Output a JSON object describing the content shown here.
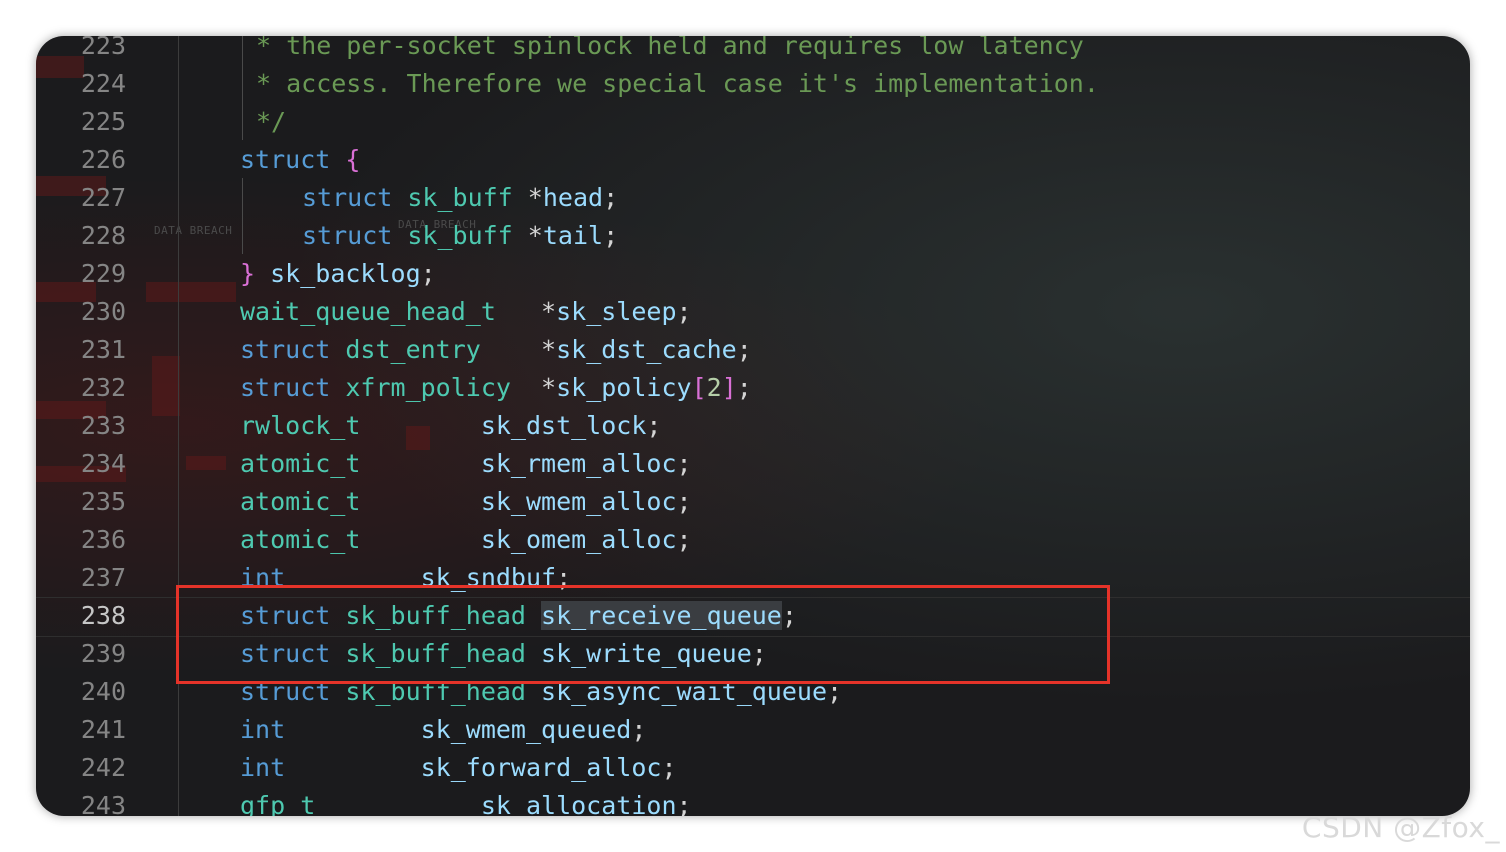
{
  "lines": [
    {
      "num": "223",
      "tokens": [
        {
          "c": "c",
          "t": "* the per-socket spinlock held and requires low latency"
        }
      ],
      "indent": 1
    },
    {
      "num": "224",
      "tokens": [
        {
          "c": "c",
          "t": "* access. Therefore we special case it's implementation."
        }
      ],
      "indent": 1
    },
    {
      "num": "225",
      "tokens": [
        {
          "c": "c",
          "t": "*/"
        }
      ],
      "indent": 1
    },
    {
      "num": "226",
      "tokens": [
        {
          "c": "k",
          "t": "struct "
        },
        {
          "c": "p",
          "t": "{"
        }
      ],
      "indent": 0
    },
    {
      "num": "227",
      "tokens": [
        {
          "c": "k",
          "t": "struct "
        },
        {
          "c": "t",
          "t": "sk_buff "
        },
        {
          "c": "d",
          "t": "*"
        },
        {
          "c": "v",
          "t": "head"
        },
        {
          "c": "d",
          "t": ";"
        }
      ],
      "indent": 2
    },
    {
      "num": "228",
      "tokens": [
        {
          "c": "k",
          "t": "struct "
        },
        {
          "c": "t",
          "t": "sk_buff "
        },
        {
          "c": "d",
          "t": "*"
        },
        {
          "c": "v",
          "t": "tail"
        },
        {
          "c": "d",
          "t": ";"
        }
      ],
      "indent": 2
    },
    {
      "num": "229",
      "tokens": [
        {
          "c": "p",
          "t": "} "
        },
        {
          "c": "v",
          "t": "sk_backlog"
        },
        {
          "c": "d",
          "t": ";"
        }
      ],
      "indent": 0
    },
    {
      "num": "230",
      "tokens": [
        {
          "c": "t",
          "t": "wait_queue_head_t   "
        },
        {
          "c": "d",
          "t": "*"
        },
        {
          "c": "v",
          "t": "sk_sleep"
        },
        {
          "c": "d",
          "t": ";"
        }
      ],
      "indent": 0
    },
    {
      "num": "231",
      "tokens": [
        {
          "c": "k",
          "t": "struct "
        },
        {
          "c": "t",
          "t": "dst_entry    "
        },
        {
          "c": "d",
          "t": "*"
        },
        {
          "c": "v",
          "t": "sk_dst_cache"
        },
        {
          "c": "d",
          "t": ";"
        }
      ],
      "indent": 0
    },
    {
      "num": "232",
      "tokens": [
        {
          "c": "k",
          "t": "struct "
        },
        {
          "c": "t",
          "t": "xfrm_policy  "
        },
        {
          "c": "d",
          "t": "*"
        },
        {
          "c": "v",
          "t": "sk_policy"
        },
        {
          "c": "p",
          "t": "["
        },
        {
          "c": "n",
          "t": "2"
        },
        {
          "c": "p",
          "t": "]"
        },
        {
          "c": "d",
          "t": ";"
        }
      ],
      "indent": 0
    },
    {
      "num": "233",
      "tokens": [
        {
          "c": "t",
          "t": "rwlock_t        "
        },
        {
          "c": "v",
          "t": "sk_dst_lock"
        },
        {
          "c": "d",
          "t": ";"
        }
      ],
      "indent": 0
    },
    {
      "num": "234",
      "tokens": [
        {
          "c": "t",
          "t": "atomic_t        "
        },
        {
          "c": "v",
          "t": "sk_rmem_alloc"
        },
        {
          "c": "d",
          "t": ";"
        }
      ],
      "indent": 0
    },
    {
      "num": "235",
      "tokens": [
        {
          "c": "t",
          "t": "atomic_t        "
        },
        {
          "c": "v",
          "t": "sk_wmem_alloc"
        },
        {
          "c": "d",
          "t": ";"
        }
      ],
      "indent": 0
    },
    {
      "num": "236",
      "tokens": [
        {
          "c": "t",
          "t": "atomic_t        "
        },
        {
          "c": "v",
          "t": "sk_omem_alloc"
        },
        {
          "c": "d",
          "t": ";"
        }
      ],
      "indent": 0
    },
    {
      "num": "237",
      "tokens": [
        {
          "c": "k",
          "t": "int         "
        },
        {
          "c": "v",
          "t": "sk_sndbuf"
        },
        {
          "c": "d",
          "t": ";"
        }
      ],
      "indent": 0
    },
    {
      "num": "238",
      "tokens": [
        {
          "c": "k",
          "t": "struct "
        },
        {
          "c": "t",
          "t": "sk_buff_head "
        },
        {
          "c": "vs",
          "t": "sk_receive_queue"
        },
        {
          "c": "d",
          "t": ";"
        }
      ],
      "indent": 0,
      "active": true
    },
    {
      "num": "239",
      "tokens": [
        {
          "c": "k",
          "t": "struct "
        },
        {
          "c": "t",
          "t": "sk_buff_head "
        },
        {
          "c": "v",
          "t": "sk_write_queue"
        },
        {
          "c": "d",
          "t": ";"
        }
      ],
      "indent": 0
    },
    {
      "num": "240",
      "tokens": [
        {
          "c": "k",
          "t": "struct "
        },
        {
          "c": "t",
          "t": "sk_buff_head "
        },
        {
          "c": "v",
          "t": "sk_async_wait_queue"
        },
        {
          "c": "d",
          "t": ";"
        }
      ],
      "indent": 0
    },
    {
      "num": "241",
      "tokens": [
        {
          "c": "k",
          "t": "int         "
        },
        {
          "c": "v",
          "t": "sk_wmem_queued"
        },
        {
          "c": "d",
          "t": ";"
        }
      ],
      "indent": 0
    },
    {
      "num": "242",
      "tokens": [
        {
          "c": "k",
          "t": "int         "
        },
        {
          "c": "v",
          "t": "sk_forward_alloc"
        },
        {
          "c": "d",
          "t": ";"
        }
      ],
      "indent": 0
    },
    {
      "num": "243",
      "tokens": [
        {
          "c": "t",
          "t": "gfp_t           "
        },
        {
          "c": "v",
          "t": "sk_allocation"
        },
        {
          "c": "d",
          "t": ";"
        }
      ],
      "indent": 0
    }
  ],
  "background_text": {
    "wm1": "DATA BREACH",
    "wm2": "DATA BREACH"
  },
  "watermark": "CSDN @Zfox_",
  "colors": {
    "highlight_box": "#e53329",
    "keyword": "#569cd6",
    "type": "#4ec9b0",
    "variable": "#9cdcfe",
    "comment": "#6a9955",
    "bracket": "#da70d6"
  }
}
